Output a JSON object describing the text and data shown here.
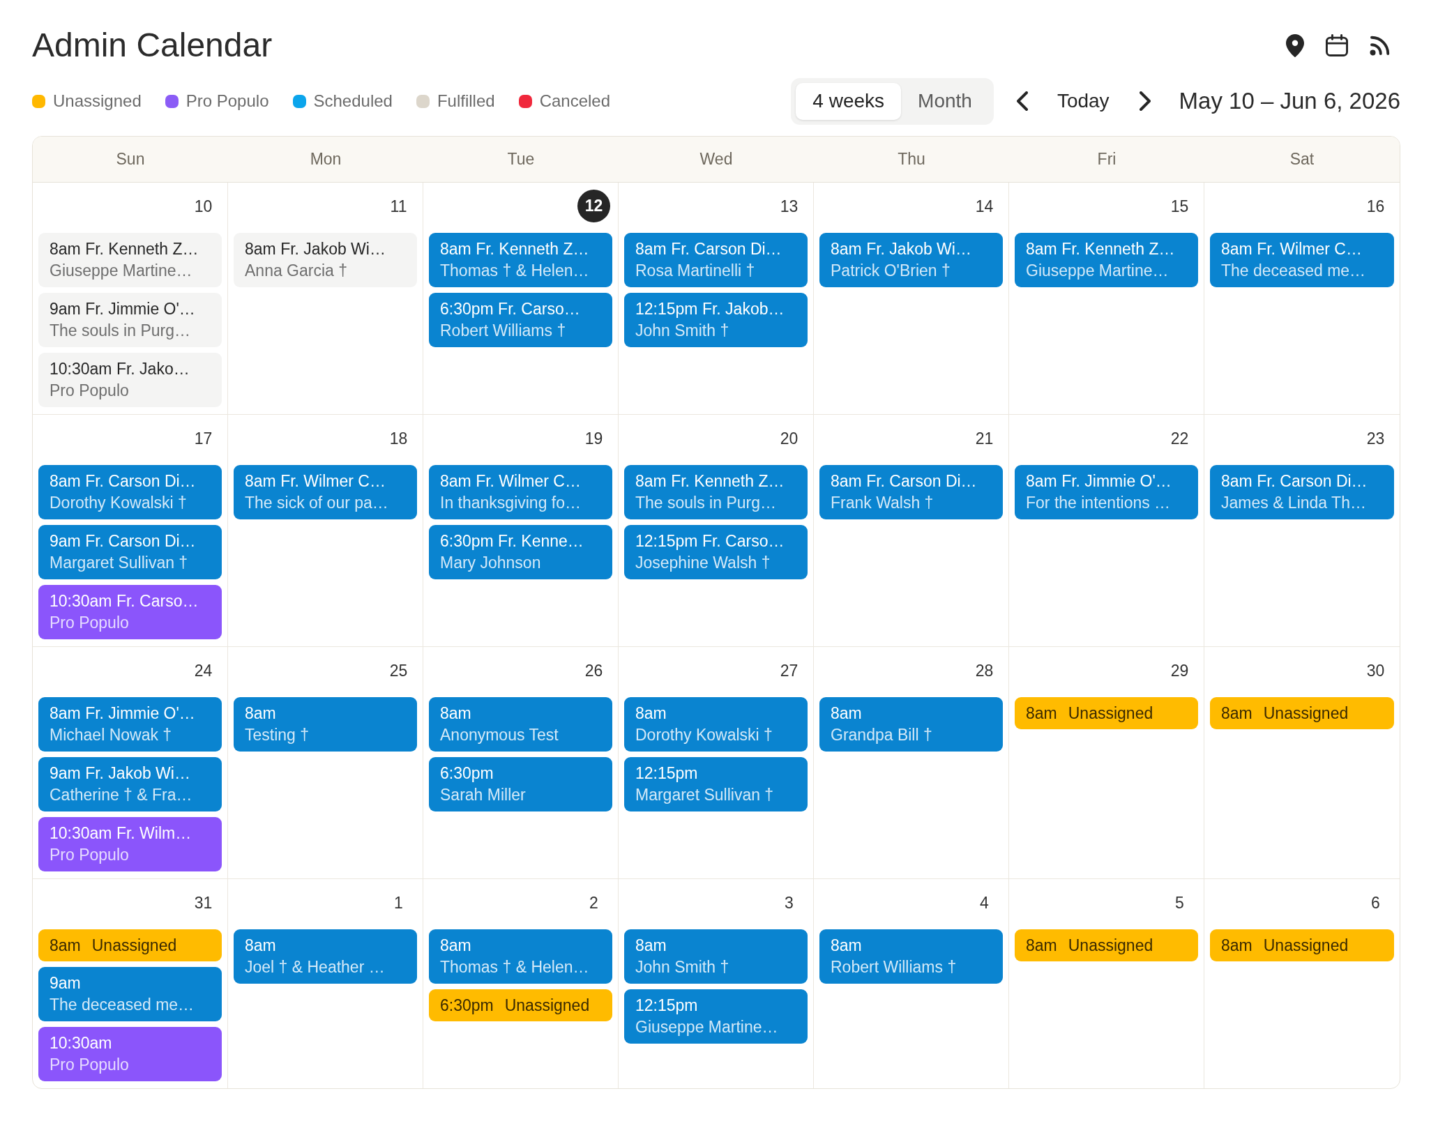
{
  "title": "Admin Calendar",
  "legend": [
    {
      "label": "Unassigned",
      "color": "#ffb800"
    },
    {
      "label": "Pro Populo",
      "color": "#8b5cf6"
    },
    {
      "label": "Scheduled",
      "color": "#0ba5ec"
    },
    {
      "label": "Fulfilled",
      "color": "#dcd6cb"
    },
    {
      "label": "Canceled",
      "color": "#f0283c"
    }
  ],
  "view_tabs": [
    {
      "label": "4 weeks",
      "selected": true
    },
    {
      "label": "Month",
      "selected": false
    }
  ],
  "navigation": {
    "today": "Today",
    "range": "May 10 – Jun 6, 2026"
  },
  "weekdays": [
    "Sun",
    "Mon",
    "Tue",
    "Wed",
    "Thu",
    "Fri",
    "Sat"
  ],
  "weeks": [
    {
      "days": [
        {
          "date": "10",
          "today": false,
          "events": [
            {
              "kind": "fulfilled",
              "title": "8am Fr. Kenneth Z…",
              "detail": "Giuseppe Martine…"
            },
            {
              "kind": "fulfilled",
              "title": "9am Fr. Jimmie O'…",
              "detail": "The souls in Purg…"
            },
            {
              "kind": "fulfilled",
              "title": "10:30am Fr. Jako…",
              "detail": "Pro Populo"
            }
          ]
        },
        {
          "date": "11",
          "today": false,
          "events": [
            {
              "kind": "fulfilled",
              "title": "8am Fr. Jakob Wi…",
              "detail": "Anna Garcia †"
            }
          ]
        },
        {
          "date": "12",
          "today": true,
          "events": [
            {
              "kind": "scheduled",
              "title": "8am Fr. Kenneth Z…",
              "detail": "Thomas † & Helen…"
            },
            {
              "kind": "scheduled",
              "title": "6:30pm Fr. Carso…",
              "detail": "Robert Williams †"
            }
          ]
        },
        {
          "date": "13",
          "today": false,
          "events": [
            {
              "kind": "scheduled",
              "title": "8am Fr. Carson Di…",
              "detail": "Rosa Martinelli †"
            },
            {
              "kind": "scheduled",
              "title": "12:15pm Fr. Jakob…",
              "detail": "John Smith †"
            }
          ]
        },
        {
          "date": "14",
          "today": false,
          "events": [
            {
              "kind": "scheduled",
              "title": "8am Fr. Jakob Wi…",
              "detail": "Patrick O'Brien †"
            }
          ]
        },
        {
          "date": "15",
          "today": false,
          "events": [
            {
              "kind": "scheduled",
              "title": "8am Fr. Kenneth Z…",
              "detail": "Giuseppe Martine…"
            }
          ]
        },
        {
          "date": "16",
          "today": false,
          "events": [
            {
              "kind": "scheduled",
              "title": "8am Fr. Wilmer C…",
              "detail": "The deceased me…"
            }
          ]
        }
      ]
    },
    {
      "days": [
        {
          "date": "17",
          "today": false,
          "events": [
            {
              "kind": "scheduled",
              "title": "8am Fr. Carson Di…",
              "detail": "Dorothy Kowalski †"
            },
            {
              "kind": "scheduled",
              "title": "9am Fr. Carson Di…",
              "detail": "Margaret Sullivan †"
            },
            {
              "kind": "pro_populo",
              "title": "10:30am Fr. Carso…",
              "detail": "Pro Populo"
            }
          ]
        },
        {
          "date": "18",
          "today": false,
          "events": [
            {
              "kind": "scheduled",
              "title": "8am Fr. Wilmer C…",
              "detail": "The sick of our pa…"
            }
          ]
        },
        {
          "date": "19",
          "today": false,
          "events": [
            {
              "kind": "scheduled",
              "title": "8am Fr. Wilmer C…",
              "detail": "In thanksgiving fo…"
            },
            {
              "kind": "scheduled",
              "title": "6:30pm Fr. Kenne…",
              "detail": "Mary Johnson"
            }
          ]
        },
        {
          "date": "20",
          "today": false,
          "events": [
            {
              "kind": "scheduled",
              "title": "8am Fr. Kenneth Z…",
              "detail": "The souls in Purg…"
            },
            {
              "kind": "scheduled",
              "title": "12:15pm Fr. Carso…",
              "detail": "Josephine Walsh †"
            }
          ]
        },
        {
          "date": "21",
          "today": false,
          "events": [
            {
              "kind": "scheduled",
              "title": "8am Fr. Carson Di…",
              "detail": "Frank Walsh †"
            }
          ]
        },
        {
          "date": "22",
          "today": false,
          "events": [
            {
              "kind": "scheduled",
              "title": "8am Fr. Jimmie O'…",
              "detail": "For the intentions …"
            }
          ]
        },
        {
          "date": "23",
          "today": false,
          "events": [
            {
              "kind": "scheduled",
              "title": "8am Fr. Carson Di…",
              "detail": "James & Linda Th…"
            }
          ]
        }
      ]
    },
    {
      "days": [
        {
          "date": "24",
          "today": false,
          "events": [
            {
              "kind": "scheduled",
              "title": "8am Fr. Jimmie O'…",
              "detail": "Michael Nowak †"
            },
            {
              "kind": "scheduled",
              "title": "9am Fr. Jakob Wi…",
              "detail": "Catherine † & Fra…"
            },
            {
              "kind": "pro_populo",
              "title": "10:30am Fr. Wilm…",
              "detail": "Pro Populo"
            }
          ]
        },
        {
          "date": "25",
          "today": false,
          "events": [
            {
              "kind": "scheduled",
              "title": "8am",
              "detail": "Testing †"
            }
          ]
        },
        {
          "date": "26",
          "today": false,
          "events": [
            {
              "kind": "scheduled",
              "title": "8am",
              "detail": "Anonymous Test"
            },
            {
              "kind": "scheduled",
              "title": "6:30pm",
              "detail": "Sarah Miller"
            }
          ]
        },
        {
          "date": "27",
          "today": false,
          "events": [
            {
              "kind": "scheduled",
              "title": "8am",
              "detail": "Dorothy Kowalski †"
            },
            {
              "kind": "scheduled",
              "title": "12:15pm",
              "detail": "Margaret Sullivan †"
            }
          ]
        },
        {
          "date": "28",
          "today": false,
          "events": [
            {
              "kind": "scheduled",
              "title": "8am",
              "detail": "Grandpa Bill †"
            }
          ]
        },
        {
          "date": "29",
          "today": false,
          "events": [
            {
              "kind": "unassigned",
              "time": "8am",
              "title": "Unassigned"
            }
          ]
        },
        {
          "date": "30",
          "today": false,
          "events": [
            {
              "kind": "unassigned",
              "time": "8am",
              "title": "Unassigned"
            }
          ]
        }
      ]
    },
    {
      "days": [
        {
          "date": "31",
          "today": false,
          "events": [
            {
              "kind": "unassigned",
              "time": "8am",
              "title": "Unassigned"
            },
            {
              "kind": "scheduled",
              "title": "9am",
              "detail": "The deceased me…"
            },
            {
              "kind": "pro_populo",
              "title": "10:30am",
              "detail": "Pro Populo"
            }
          ]
        },
        {
          "date": "1",
          "today": false,
          "events": [
            {
              "kind": "scheduled",
              "title": "8am",
              "detail": "Joel † & Heather …"
            }
          ]
        },
        {
          "date": "2",
          "today": false,
          "events": [
            {
              "kind": "scheduled",
              "title": "8am",
              "detail": "Thomas † & Helen…"
            },
            {
              "kind": "unassigned",
              "time": "6:30pm",
              "title": "Unassigned"
            }
          ]
        },
        {
          "date": "3",
          "today": false,
          "events": [
            {
              "kind": "scheduled",
              "title": "8am",
              "detail": "John Smith †"
            },
            {
              "kind": "scheduled",
              "title": "12:15pm",
              "detail": "Giuseppe Martine…"
            }
          ]
        },
        {
          "date": "4",
          "today": false,
          "events": [
            {
              "kind": "scheduled",
              "title": "8am",
              "detail": "Robert Williams †"
            }
          ]
        },
        {
          "date": "5",
          "today": false,
          "events": [
            {
              "kind": "unassigned",
              "time": "8am",
              "title": "Unassigned"
            }
          ]
        },
        {
          "date": "6",
          "today": false,
          "events": [
            {
              "kind": "unassigned",
              "time": "8am",
              "title": "Unassigned"
            }
          ]
        }
      ]
    }
  ]
}
